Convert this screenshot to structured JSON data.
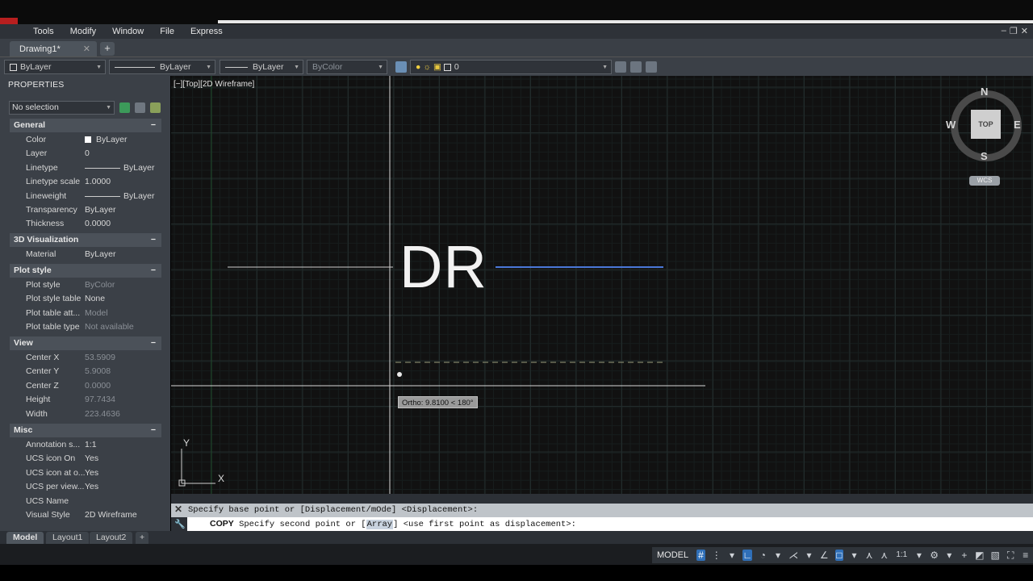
{
  "menu": {
    "items": [
      "Tools",
      "Modify",
      "Window",
      "File",
      "Express"
    ]
  },
  "document_tab": {
    "label": "Drawing1*",
    "close": "✕",
    "new_tab": "+"
  },
  "toolbar": {
    "color": "ByLayer",
    "linetype": "ByLayer",
    "lineweight": "ByLayer",
    "plotstyle": "ByColor",
    "layer": "0"
  },
  "palette": {
    "title": "PROPERTIES",
    "selection": "No selection",
    "sections": {
      "general": "General",
      "viz": "3D Visualization",
      "plot": "Plot style",
      "view": "View",
      "misc": "Misc"
    },
    "general": {
      "color_k": "Color",
      "color_v": "ByLayer",
      "layer_k": "Layer",
      "layer_v": "0",
      "linetype_k": "Linetype",
      "linetype_v": "ByLayer",
      "ltscale_k": "Linetype scale",
      "ltscale_v": "1.0000",
      "lineweight_k": "Lineweight",
      "lineweight_v": "ByLayer",
      "transparency_k": "Transparency",
      "transparency_v": "ByLayer",
      "thickness_k": "Thickness",
      "thickness_v": "0.0000"
    },
    "viz": {
      "material_k": "Material",
      "material_v": "ByLayer"
    },
    "plot": {
      "style_k": "Plot style",
      "style_v": "ByColor",
      "table_k": "Plot style table",
      "table_v": "None",
      "att_k": "Plot table att...",
      "att_v": "Model",
      "type_k": "Plot table type",
      "type_v": "Not available"
    },
    "view": {
      "cx_k": "Center X",
      "cx_v": "53.5909",
      "cy_k": "Center Y",
      "cy_v": "5.9008",
      "cz_k": "Center Z",
      "cz_v": "0.0000",
      "h_k": "Height",
      "h_v": "97.7434",
      "w_k": "Width",
      "w_v": "223.4636"
    },
    "misc": {
      "ann_k": "Annotation s...",
      "ann_v": "1:1",
      "ucson_k": "UCS icon On",
      "ucson_v": "Yes",
      "ucsat_k": "UCS icon at o...",
      "ucsat_v": "Yes",
      "ucsper_k": "UCS per view...",
      "ucsper_v": "Yes",
      "ucsname_k": "UCS Name",
      "ucsname_v": "",
      "vstyle_k": "Visual Style",
      "vstyle_v": "2D Wireframe"
    }
  },
  "canvas": {
    "viewport_label": "[−][Top][2D Wireframe]",
    "text": "DR",
    "ortho_tooltip": "Ortho: 9.8100 < 180°",
    "ucs_x": "X",
    "ucs_y": "Y"
  },
  "viewcube": {
    "top": "TOP",
    "n": "N",
    "s": "S",
    "e": "E",
    "w": "W",
    "wcs": "WCS"
  },
  "command": {
    "history": "Specify base point or [Displacement/mOde] <Displacement>:",
    "prompt_cmd": "COPY",
    "prompt_pre": " Specify second point or [",
    "prompt_opt": "Array",
    "prompt_post": "] <use first point as displacement>:"
  },
  "layout_tabs": {
    "model": "Model",
    "layout1": "Layout1",
    "layout2": "Layout2",
    "add": "+"
  },
  "status": {
    "model": "MODEL",
    "scale": "1:1"
  },
  "colors": {
    "accent": "#2f6fb8",
    "canvas_bg": "#111111",
    "grid_major": "#1f2a2a",
    "selected_line": "#4a78d8"
  }
}
